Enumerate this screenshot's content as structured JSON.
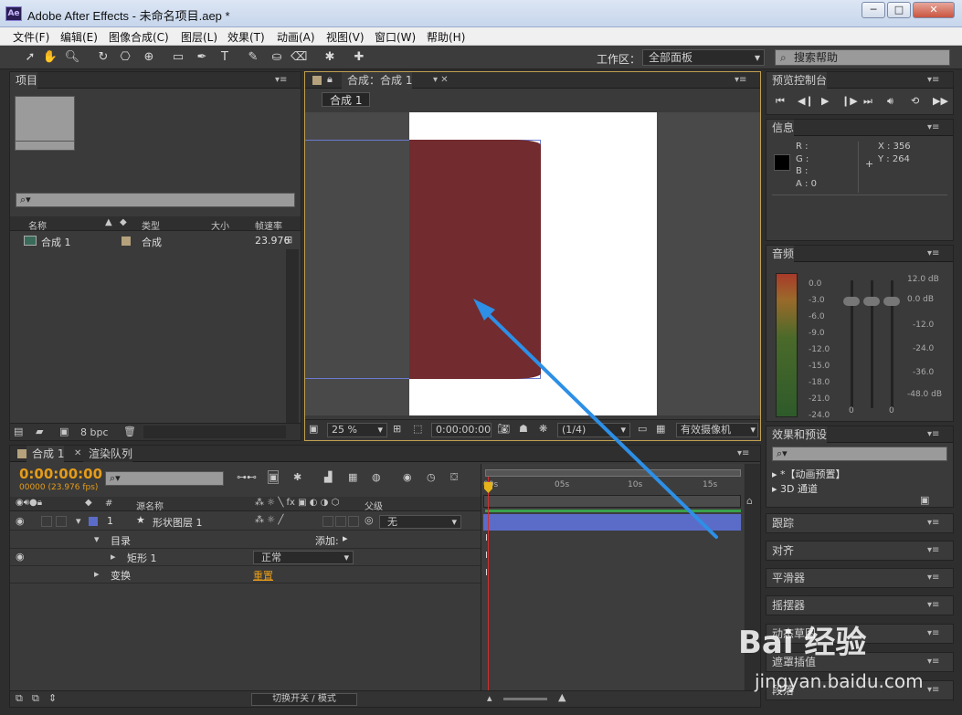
{
  "window": {
    "title": "Adobe After Effects - 未命名项目.aep *",
    "logo": "Ae"
  },
  "menu": [
    "文件(F)",
    "编辑(E)",
    "图像合成(C)",
    "图层(L)",
    "效果(T)",
    "动画(A)",
    "视图(V)",
    "窗口(W)",
    "帮助(H)"
  ],
  "toolbar": {
    "workspace_label": "工作区：",
    "workspace_value": "全部面板",
    "search_placeholder": "搜索帮助"
  },
  "project": {
    "tab": "项目",
    "columns": [
      "名称",
      "类型",
      "大小",
      "帧速率"
    ],
    "items": [
      {
        "name": "合成 1",
        "type": "合成",
        "size": "",
        "fps": "23.976"
      }
    ],
    "bpc": "8 bpc"
  },
  "composition": {
    "tab": "合成：合成 1",
    "subtab": "合成 1",
    "zoom": "25 %",
    "timecode": "0:00:00:00",
    "resolution": "(1/4)",
    "camera": "有效摄像机"
  },
  "preview": {
    "tab": "预览控制台"
  },
  "info": {
    "tab": "信息",
    "r": "R :",
    "g": "G :",
    "b": "B :",
    "a": "A : 0",
    "x": "X : 356",
    "y": "Y : 264"
  },
  "audio": {
    "tab": "音频",
    "left_scale": [
      "0.0",
      "-3.0",
      "-6.0",
      "-9.0",
      "-12.0",
      "-15.0",
      "-18.0",
      "-21.0",
      "-24.0"
    ],
    "right_scale": [
      "12.0 dB",
      "0.0 dB",
      "-12.0",
      "-24.0",
      "-36.0",
      "-48.0 dB"
    ],
    "bottom": [
      "0",
      "0"
    ]
  },
  "effects": {
    "tab": "效果和预设",
    "items": [
      "*【动画预置】",
      "3D 通道"
    ]
  },
  "side_panels": [
    "跟踪",
    "对齐",
    "平滑器",
    "摇摆器",
    "动态草图",
    "遮罩插值",
    "段落"
  ],
  "timeline": {
    "tab": "合成 1",
    "render_tab": "渲染队列",
    "timecode": "0:00:00:00",
    "fps_label": "00000 (23.976 fps)",
    "col_num": "#",
    "col_source": "源名称",
    "col_parent": "父级",
    "layers": [
      {
        "num": "1",
        "name": "形状图层 1",
        "parent": "无"
      }
    ],
    "rows": {
      "contents": "目录",
      "add": "添加:",
      "rect": "矩形 1",
      "mode": "正常",
      "transform": "变换",
      "reset": "重置"
    },
    "ruler": [
      "00s",
      "05s",
      "10s",
      "15s"
    ],
    "footer": "切换开关 / 模式"
  },
  "watermark": {
    "brand": "Bai 经验",
    "url": "jingyan.baidu.com"
  },
  "colors": {
    "shape_fill": "#722b2e",
    "layer_bar": "#5b6cc8",
    "arrow": "#2d8fe6",
    "timecode": "#e59c19"
  }
}
